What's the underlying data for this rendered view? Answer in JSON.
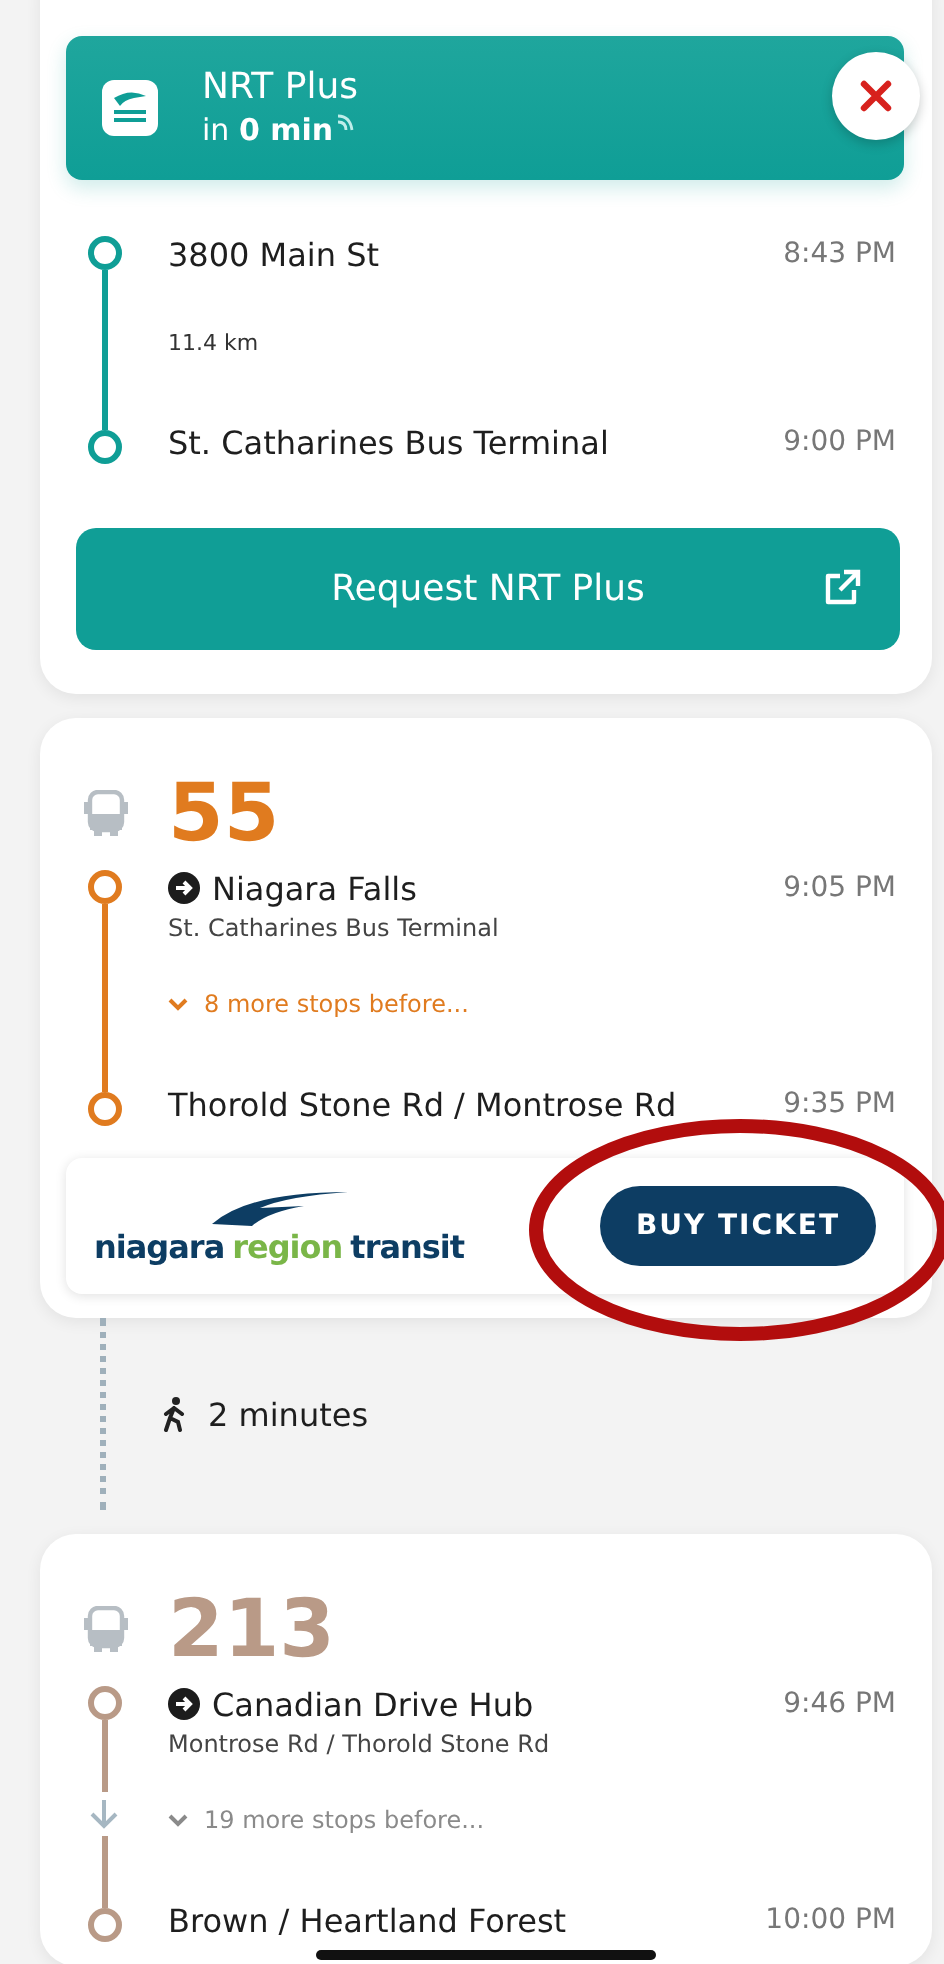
{
  "on_demand": {
    "title": "NRT Plus",
    "eta": "in **0 min**",
    "legs": [
      {
        "color": "#0f9e96",
        "arrow": false,
        "stops": [
          {
            "name": "3800 Main St",
            "time": "8:43 PM"
          },
          {
            "name": "St. Catharines Bus Terminal",
            "time": "9:00 PM"
          }
        ],
        "distance": "11.4 km"
      }
    ],
    "request_button": "Request NRT Plus"
  },
  "routes": [
    {
      "route": "55",
      "color": "#e07b1f",
      "arrow": false,
      "headsign": "Niagara Falls",
      "from": "St. Catharines Bus Terminal",
      "depart": "9:05 PM",
      "more_stops": "8 more stops before...",
      "last_stop": "Thorold Stone Rd / Montrose Rd",
      "arrive": "9:35 PM",
      "operator": {
        "logo": [
          "niagara",
          "region",
          "transit"
        ],
        "buy_button": "BUY TICKET"
      }
    },
    {
      "route": "213",
      "color": "#b99a87",
      "arrow": true,
      "headsign": "Canadian Drive Hub",
      "from": "Montrose Rd / Thorold Stone Rd",
      "depart": "9:46 PM",
      "more_stops": "19 more stops before...",
      "last_stop": "Brown / Heartland Forest",
      "arrive": "10:00 PM"
    }
  ],
  "walk": "2 minutes"
}
